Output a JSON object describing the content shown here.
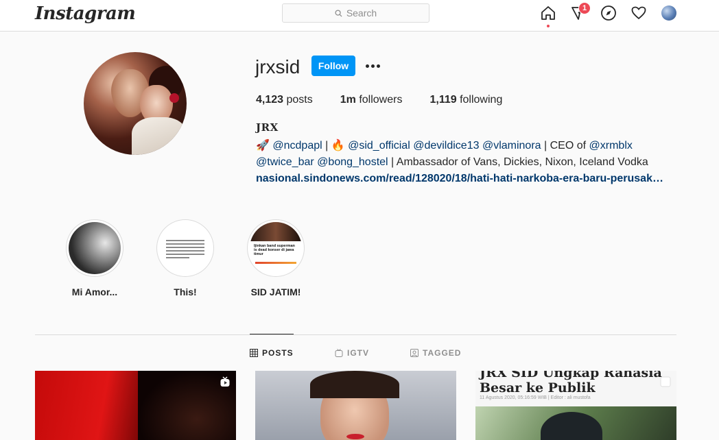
{
  "nav": {
    "logo": "Instagram",
    "search_placeholder": "Search",
    "notification_count": "1"
  },
  "profile": {
    "username": "jrxsid",
    "follow_label": "Follow",
    "stats": {
      "posts_count": "4,123",
      "posts_label": "posts",
      "followers_count": "1m",
      "followers_label": "followers",
      "following_count": "1,119",
      "following_label": "following"
    },
    "full_name": "𝐉𝐑𝐗",
    "bio": {
      "rocket": "🚀",
      "mention_ncdpapl": "@ncdpapl",
      "sep1": " | ",
      "fire": "🔥",
      "mention_sid_official": "@sid_official",
      "mention_devildice13": "@devildice13",
      "mention_vlaminora": "@vlaminora",
      "ceo_of": " | CEO of ",
      "mention_xrmblx": "@xrmblx",
      "mention_twice_bar": "@twice_bar",
      "mention_bong_hostel": "@bong_hostel",
      "ambassador": " | Ambassador of Vans, Dickies, Nixon, Iceland Vodka",
      "link": "nasional.sindonews.com/read/128020/18/hati-hati-narkoba-era-baru-perusak…"
    }
  },
  "highlights": [
    {
      "label": "Mi Amor..."
    },
    {
      "label": "This!"
    },
    {
      "label": "SID JATIM!",
      "thumb_text": "Ijinkan band superman is dead konser di jawa timur"
    }
  ],
  "tabs": [
    {
      "label": "POSTS",
      "active": true
    },
    {
      "label": "IGTV",
      "active": false
    },
    {
      "label": "TAGGED",
      "active": false
    }
  ],
  "posts": [
    {
      "kind": "igtv"
    },
    {
      "kind": "photo"
    },
    {
      "kind": "carousel",
      "headline": "JRX SID Ungkap Rahasia Besar ke Publik",
      "meta": "11 Agustus 2020, 05:16:59 WIB | Editor : ali mustofa"
    }
  ],
  "colors": {
    "follow_button": "#0095f6",
    "badge": "#ed4956",
    "link": "#00376b"
  }
}
